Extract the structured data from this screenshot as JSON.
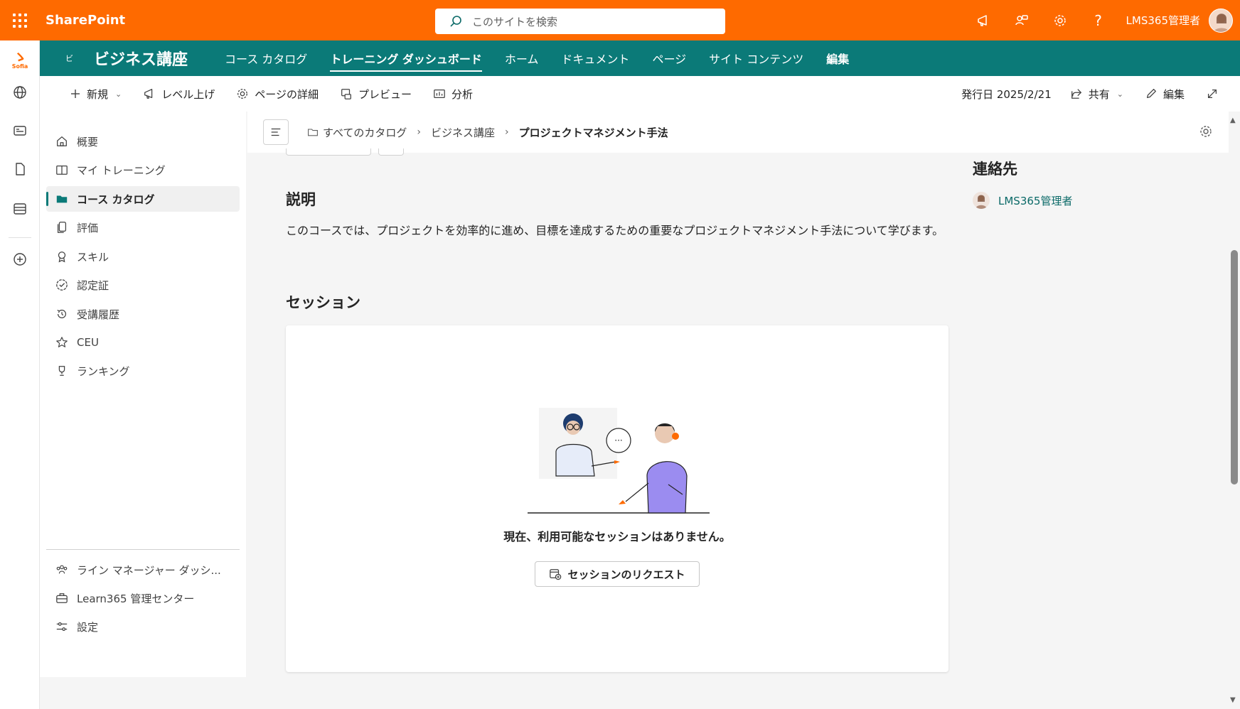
{
  "suite": {
    "app_name": "SharePoint",
    "search_placeholder": "このサイトを検索",
    "user_name": "LMS365管理者"
  },
  "appbar": {
    "logo_text": "Sofia"
  },
  "site": {
    "initial": "ビ",
    "title": "ビジネス講座",
    "nav": [
      "コース カタログ",
      "トレーニング ダッシュボード",
      "ホーム",
      "ドキュメント",
      "ページ",
      "サイト コンテンツ",
      "編集"
    ],
    "active_nav": "トレーニング ダッシュボード"
  },
  "command": {
    "new": "新規",
    "promote": "レベル上げ",
    "page_details": "ページの詳細",
    "preview": "プレビュー",
    "analytics": "分析",
    "published": "発行日 2025/2/21",
    "share": "共有",
    "edit": "編集"
  },
  "course_nav": {
    "items": [
      {
        "label": "概要",
        "icon": "home-icon"
      },
      {
        "label": "マイ トレーニング",
        "icon": "book-icon"
      },
      {
        "label": "コース カタログ",
        "icon": "folder-icon",
        "active": true
      },
      {
        "label": "評価",
        "icon": "copy-icon"
      },
      {
        "label": "スキル",
        "icon": "ribbon-icon"
      },
      {
        "label": "認定証",
        "icon": "certificate-icon"
      },
      {
        "label": "受講履歴",
        "icon": "history-icon"
      },
      {
        "label": "CEU",
        "icon": "star-icon"
      },
      {
        "label": "ランキング",
        "icon": "trophy-icon"
      }
    ],
    "bottom_items": [
      {
        "label": "ライン マネージャー ダッシ...",
        "icon": "people-icon"
      },
      {
        "label": "Learn365 管理センター",
        "icon": "toolbox-icon"
      },
      {
        "label": "設定",
        "icon": "sliders-icon"
      }
    ]
  },
  "breadcrumb": {
    "items": [
      "すべてのカタログ",
      "ビジネス講座",
      "プロジェクトマネジメント手法"
    ]
  },
  "main": {
    "description_title": "説明",
    "description_text": "このコースでは、プロジェクトを効率的に進め、目標を達成するための重要なプロジェクトマネジメント手法について学びます。",
    "sessions_title": "セッション",
    "empty_message": "現在、利用可能なセッションはありません。",
    "request_button": "セッションのリクエスト"
  },
  "contact": {
    "title": "連絡先",
    "name": "LMS365管理者"
  },
  "colors": {
    "suite_bar": "#fe6a00",
    "site_header": "#0b7a78",
    "link": "#0b6a68"
  }
}
